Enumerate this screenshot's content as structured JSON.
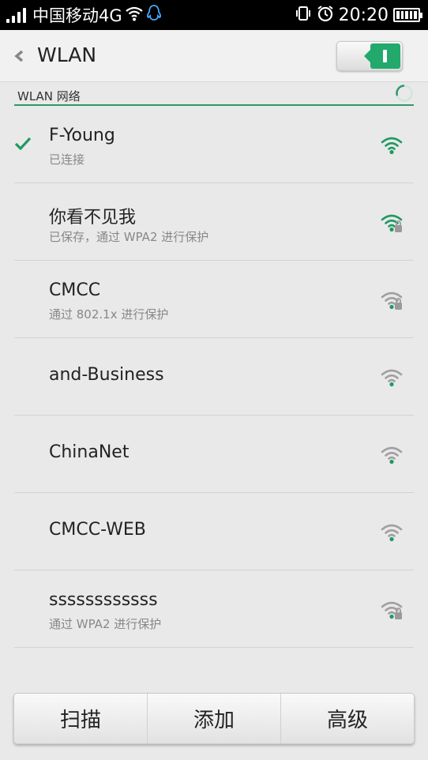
{
  "status_bar": {
    "carrier": "中国移动4G",
    "time": "20:20"
  },
  "header": {
    "title": "WLAN",
    "wlan_enabled": true
  },
  "section": {
    "label": "WLAN 网络"
  },
  "networks": [
    {
      "name": "F-Young",
      "status": "已连接",
      "connected": true,
      "secured": false,
      "signal_color": "#1f9a62"
    },
    {
      "name": "你看不见我",
      "status": "已保存，通过 WPA2 进行保护",
      "connected": false,
      "secured": true,
      "signal_color": "#1f9a62"
    },
    {
      "name": "CMCC",
      "status": "通过 802.1x 进行保护",
      "connected": false,
      "secured": true,
      "signal_color": "#a0a0a0"
    },
    {
      "name": "and-Business",
      "status": "",
      "connected": false,
      "secured": false,
      "signal_color": "#a0a0a0"
    },
    {
      "name": "ChinaNet",
      "status": "",
      "connected": false,
      "secured": false,
      "signal_color": "#a0a0a0"
    },
    {
      "name": "CMCC-WEB",
      "status": "",
      "connected": false,
      "secured": false,
      "signal_color": "#a0a0a0"
    },
    {
      "name": "ssssssssssss",
      "status": "通过 WPA2 进行保护",
      "connected": false,
      "secured": true,
      "signal_color": "#a0a0a0"
    }
  ],
  "bottom_bar": {
    "scan_label": "扫描",
    "add_label": "添加",
    "advanced_label": "高级"
  },
  "colors": {
    "accent": "#23a96c",
    "signal_strong": "#1f9a62",
    "signal_weak": "#a0a0a0"
  }
}
